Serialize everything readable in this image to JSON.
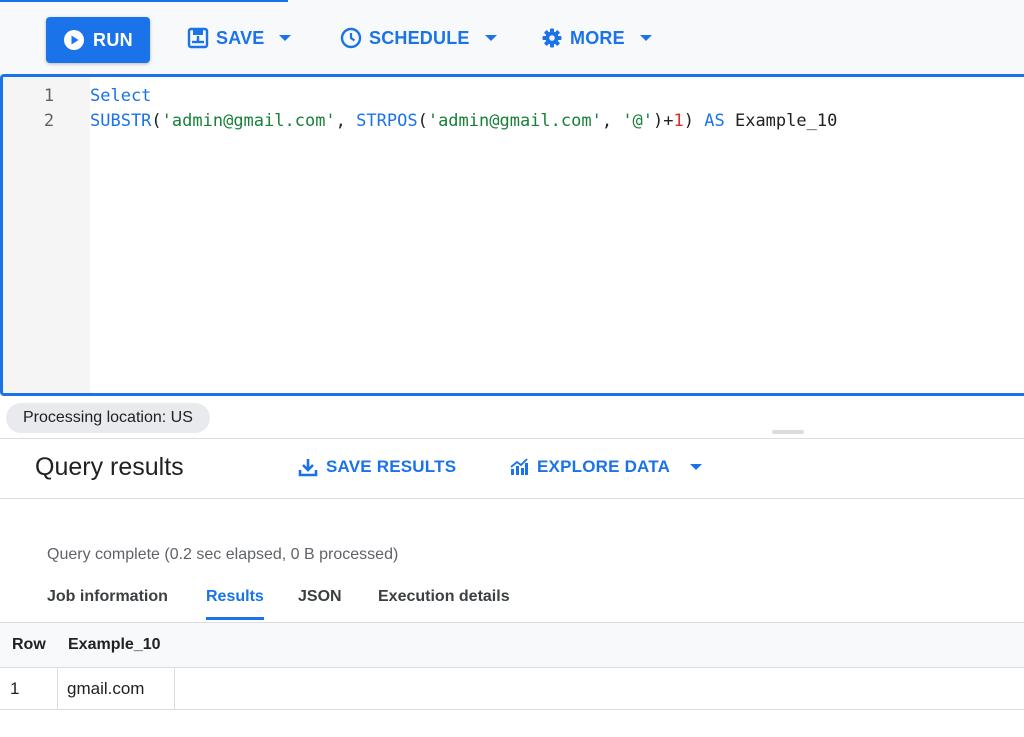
{
  "toolbar": {
    "run_label": "RUN",
    "save_label": "SAVE",
    "schedule_label": "SCHEDULE",
    "more_label": "MORE"
  },
  "editor": {
    "lines": [
      {
        "number": "1",
        "tokens": [
          {
            "text": "Select",
            "kind": "kw"
          }
        ]
      },
      {
        "number": "2",
        "tokens": [
          {
            "text": "SUBSTR",
            "kind": "kw"
          },
          {
            "text": "(",
            "kind": "plain"
          },
          {
            "text": "'admin@gmail.com'",
            "kind": "str"
          },
          {
            "text": ", ",
            "kind": "plain"
          },
          {
            "text": "STRPOS",
            "kind": "kw"
          },
          {
            "text": "(",
            "kind": "plain"
          },
          {
            "text": "'admin@gmail.com'",
            "kind": "str"
          },
          {
            "text": ", ",
            "kind": "plain"
          },
          {
            "text": "'@'",
            "kind": "str"
          },
          {
            "text": ")+",
            "kind": "plain"
          },
          {
            "text": "1",
            "kind": "num"
          },
          {
            "text": ") ",
            "kind": "plain"
          },
          {
            "text": "AS",
            "kind": "kw"
          },
          {
            "text": " Example_10",
            "kind": "plain"
          }
        ]
      }
    ]
  },
  "processing_location": "Processing location: US",
  "results": {
    "title": "Query results",
    "save_results_label": "SAVE RESULTS",
    "explore_data_label": "EXPLORE DATA",
    "status": "Query complete (0.2 sec elapsed, 0 B processed)",
    "tabs": [
      {
        "label": "Job information",
        "active": false
      },
      {
        "label": "Results",
        "active": true
      },
      {
        "label": "JSON",
        "active": false
      },
      {
        "label": "Execution details",
        "active": false
      }
    ],
    "table": {
      "columns": [
        "Row",
        "Example_10"
      ],
      "rows": [
        [
          "1",
          "gmail.com"
        ]
      ]
    }
  },
  "colors": {
    "accent": "#1a73e8",
    "string": "#188038",
    "number": "#d93025"
  },
  "icons": {
    "run": "play-circle-icon",
    "save": "save-icon",
    "schedule": "clock-icon",
    "more": "gear-icon",
    "save_results": "download-icon",
    "explore_data": "explore-chart-icon"
  }
}
